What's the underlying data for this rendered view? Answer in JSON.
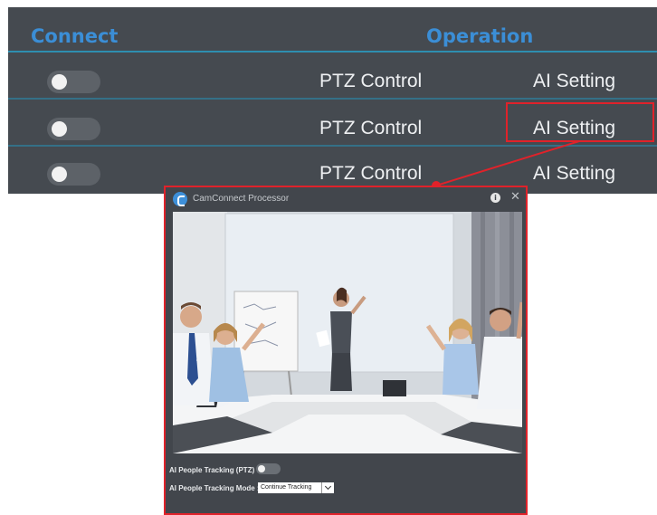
{
  "table": {
    "headers": {
      "connect": "Connect",
      "operation": "Operation"
    },
    "rows": [
      {
        "connected": false,
        "ptz": "PTZ Control",
        "ai": "AI Setting"
      },
      {
        "connected": false,
        "ptz": "PTZ Control",
        "ai": "AI Setting",
        "highlighted": true
      },
      {
        "connected": false,
        "ptz": "PTZ Control",
        "ai": "AI Setting"
      }
    ]
  },
  "processor": {
    "title": "CamConnect Processor",
    "settings": {
      "tracking_label": "AI People Tracking (PTZ) :",
      "tracking_enabled": false,
      "mode_label": "AI People Tracking Mode :",
      "mode_value": "Continue Tracking"
    }
  },
  "colors": {
    "header_text": "#3b8ed6",
    "table_bg": "#454a50",
    "highlight": "#e0222a",
    "window_bg": "#42464c"
  },
  "icons": {
    "app": "camconnect-logo-icon",
    "info": "info-icon",
    "close": "close-icon",
    "dropdown": "chevron-down-icon"
  }
}
